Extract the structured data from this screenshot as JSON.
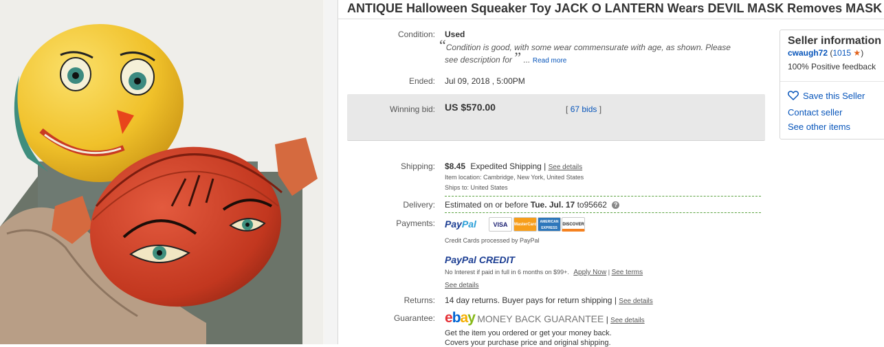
{
  "title": "ANTIQUE Halloween Squeaker Toy JACK O LANTERN Wears DEVIL MASK Removes MASK",
  "condition": {
    "label": "Condition:",
    "value": "Used",
    "quote_open": "“",
    "description_line1": "Condition is good, with some wear commensurate with age, as shown. Please",
    "description_line2": "see description for",
    "quote_close": "”",
    "ellipsis": "...",
    "read_more": "Read more"
  },
  "ended": {
    "label": "Ended:",
    "value": "Jul 09, 2018 , 5:00PM"
  },
  "winning_bid": {
    "label": "Winning bid:",
    "amount": "US $570.00",
    "bids_open": "[",
    "bids_link": "67 bids",
    "bids_close": "]"
  },
  "shipping": {
    "label": "Shipping:",
    "cost": "$8.45",
    "method": "Expedited Shipping",
    "separator": "|",
    "see_details": "See details",
    "location_label": "Item location:",
    "location": "Cambridge, New York, United States",
    "ships_to_label": "Ships to:",
    "ships_to": "United States"
  },
  "delivery": {
    "label": "Delivery:",
    "prefix": "Estimated on or before",
    "date": "Tue. Jul. 17",
    "to": "to",
    "zip": "95662",
    "help_icon": "?"
  },
  "payments": {
    "label": "Payments:",
    "paypal_a": "Pay",
    "paypal_b": "Pal",
    "cards": [
      "VISA",
      "MasterCard",
      "AMERICAN EXPRESS",
      "DISCOVER"
    ],
    "cards_note": "Credit Cards processed by PayPal",
    "credit_a": "PayPal",
    "credit_b": "CREDIT",
    "credit_note": "No Interest if paid in full in 6 months on $99+.",
    "apply_now": "Apply Now",
    "separator": "|",
    "see_terms": "See terms",
    "see_details": "See details"
  },
  "returns": {
    "label": "Returns:",
    "value": "14 day returns. Buyer pays for return shipping",
    "separator": "|",
    "see_details": "See details"
  },
  "guarantee": {
    "label": "Guarantee:",
    "ebay": [
      "e",
      "b",
      "a",
      "y"
    ],
    "mbg": "MONEY BACK GUARANTEE",
    "separator": "|",
    "see_details": "See details",
    "line1": "Get the item you ordered or get your money back.",
    "line2": "Covers your purchase price and original shipping."
  },
  "seller": {
    "title": "Seller information",
    "name": "cwaugh72",
    "feedback_open": "(",
    "feedback_count": "1015",
    "feedback_close": ")",
    "positive": "100% Positive feedback",
    "save": "Save this Seller",
    "contact": "Contact seller",
    "other_items": "See other items"
  },
  "colors": {
    "link": "#0654ba",
    "bid_box": "#e8e8e8",
    "dash_green": "#5ba240",
    "star": "#e2621b"
  }
}
